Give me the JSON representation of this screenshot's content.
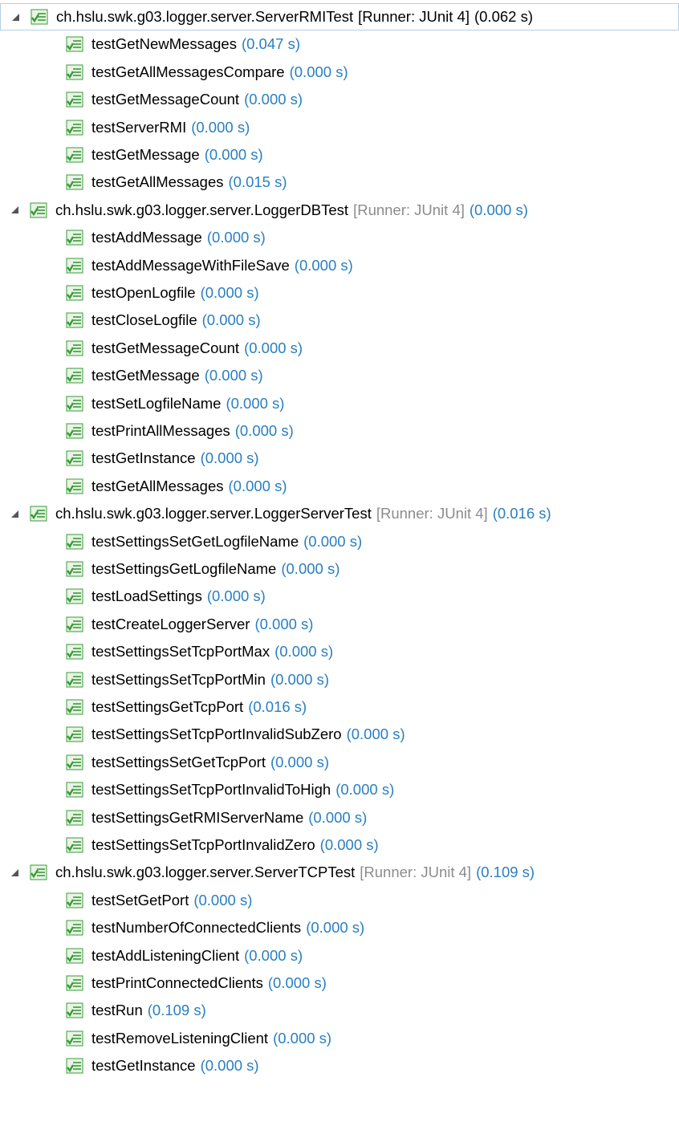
{
  "colors": {
    "name": "#000000",
    "runner": "#8c8c8c",
    "time": "#2a7fc0",
    "icon_green": "#3a9b3a",
    "icon_bg": "#e8f4e4"
  },
  "icons": {
    "suite": "test-suite-passed-icon",
    "test": "test-case-passed-icon",
    "twisty": "tree-expanded-icon"
  },
  "suites": [
    {
      "name": "ch.hslu.swk.g03.logger.server.ServerRMITest",
      "runner": "[Runner: JUnit 4]",
      "time": "(0.062 s)",
      "runner_style": "plain",
      "tests": [
        {
          "name": "testGetNewMessages",
          "time": "(0.047 s)"
        },
        {
          "name": "testGetAllMessagesCompare",
          "time": "(0.000 s)"
        },
        {
          "name": "testGetMessageCount",
          "time": "(0.000 s)"
        },
        {
          "name": "testServerRMI",
          "time": "(0.000 s)"
        },
        {
          "name": "testGetMessage",
          "time": "(0.000 s)"
        },
        {
          "name": "testGetAllMessages",
          "time": "(0.015 s)"
        }
      ]
    },
    {
      "name": "ch.hslu.swk.g03.logger.server.LoggerDBTest",
      "runner": "[Runner: JUnit 4]",
      "time": "(0.000 s)",
      "runner_style": "muted",
      "tests": [
        {
          "name": "testAddMessage",
          "time": "(0.000 s)"
        },
        {
          "name": "testAddMessageWithFileSave",
          "time": "(0.000 s)"
        },
        {
          "name": "testOpenLogfile",
          "time": "(0.000 s)"
        },
        {
          "name": "testCloseLogfile",
          "time": "(0.000 s)"
        },
        {
          "name": "testGetMessageCount",
          "time": "(0.000 s)"
        },
        {
          "name": "testGetMessage",
          "time": "(0.000 s)"
        },
        {
          "name": "testSetLogfileName",
          "time": "(0.000 s)"
        },
        {
          "name": "testPrintAllMessages",
          "time": "(0.000 s)"
        },
        {
          "name": "testGetInstance",
          "time": "(0.000 s)"
        },
        {
          "name": "testGetAllMessages",
          "time": "(0.000 s)"
        }
      ]
    },
    {
      "name": "ch.hslu.swk.g03.logger.server.LoggerServerTest",
      "runner": "[Runner: JUnit 4]",
      "time": "(0.016 s)",
      "runner_style": "muted",
      "tests": [
        {
          "name": "testSettingsSetGetLogfileName",
          "time": "(0.000 s)"
        },
        {
          "name": "testSettingsGetLogfileName",
          "time": "(0.000 s)"
        },
        {
          "name": "testLoadSettings",
          "time": "(0.000 s)"
        },
        {
          "name": "testCreateLoggerServer",
          "time": "(0.000 s)"
        },
        {
          "name": "testSettingsSetTcpPortMax",
          "time": "(0.000 s)"
        },
        {
          "name": "testSettingsSetTcpPortMin",
          "time": "(0.000 s)"
        },
        {
          "name": "testSettingsGetTcpPort",
          "time": "(0.016 s)"
        },
        {
          "name": "testSettingsSetTcpPortInvalidSubZero",
          "time": "(0.000 s)"
        },
        {
          "name": "testSettingsSetGetTcpPort",
          "time": "(0.000 s)"
        },
        {
          "name": "testSettingsSetTcpPortInvalidToHigh",
          "time": "(0.000 s)"
        },
        {
          "name": "testSettingsGetRMIServerName",
          "time": "(0.000 s)"
        },
        {
          "name": "testSettingsSetTcpPortInvalidZero",
          "time": "(0.000 s)"
        }
      ]
    },
    {
      "name": "ch.hslu.swk.g03.logger.server.ServerTCPTest",
      "runner": "[Runner: JUnit 4]",
      "time": "(0.109 s)",
      "runner_style": "muted",
      "tests": [
        {
          "name": "testSetGetPort",
          "time": "(0.000 s)"
        },
        {
          "name": "testNumberOfConnectedClients",
          "time": "(0.000 s)"
        },
        {
          "name": "testAddListeningClient",
          "time": "(0.000 s)"
        },
        {
          "name": "testPrintConnectedClients",
          "time": "(0.000 s)"
        },
        {
          "name": "testRun",
          "time": "(0.109 s)"
        },
        {
          "name": "testRemoveListeningClient",
          "time": "(0.000 s)"
        },
        {
          "name": "testGetInstance",
          "time": "(0.000 s)"
        }
      ]
    }
  ]
}
